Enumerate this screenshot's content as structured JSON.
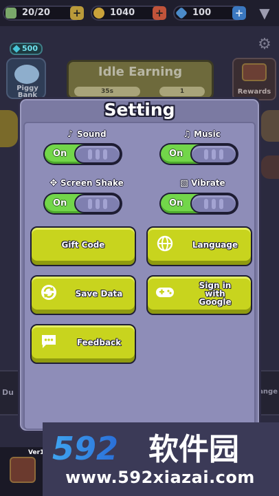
{
  "resources": {
    "energy": "20/20",
    "coins": "1040",
    "gems": "100"
  },
  "background": {
    "gem_badge": "500",
    "piggy_label": "Piggy Bank",
    "idle_title": "Idle Earning",
    "idle_timer": "35s",
    "idle_count": "1",
    "rewards_label": "Rewards",
    "left_strip_label": "Du",
    "right_strip_label": "ange"
  },
  "settings": {
    "title": "Setting",
    "sound": {
      "label": "Sound",
      "icon": "music-note-icon",
      "state": "On"
    },
    "music": {
      "label": "Music",
      "icon": "music-notes-icon",
      "state": "On"
    },
    "screen_shake": {
      "label": "Screen Shake",
      "icon": "screen-shake-icon",
      "state": "On"
    },
    "vibrate": {
      "label": "Vibrate",
      "icon": "vibrate-icon",
      "state": "On"
    },
    "buttons": {
      "gift_code": "Gift Code",
      "language": "Language",
      "save_data": "Save Data",
      "google_line1": "Sign in",
      "google_line2": "with",
      "google_line3": "Google",
      "feedback": "Feedback"
    },
    "version": "Ver1.0"
  },
  "watermark": {
    "logo": "592软件园",
    "url": "www.592xiazai.com"
  },
  "colors": {
    "modal_bg": "#7b7aa2",
    "panel_bg": "#8e8db8",
    "button": "#c8d41e",
    "toggle_on": "#72d64a",
    "outline": "#1e1d33"
  }
}
